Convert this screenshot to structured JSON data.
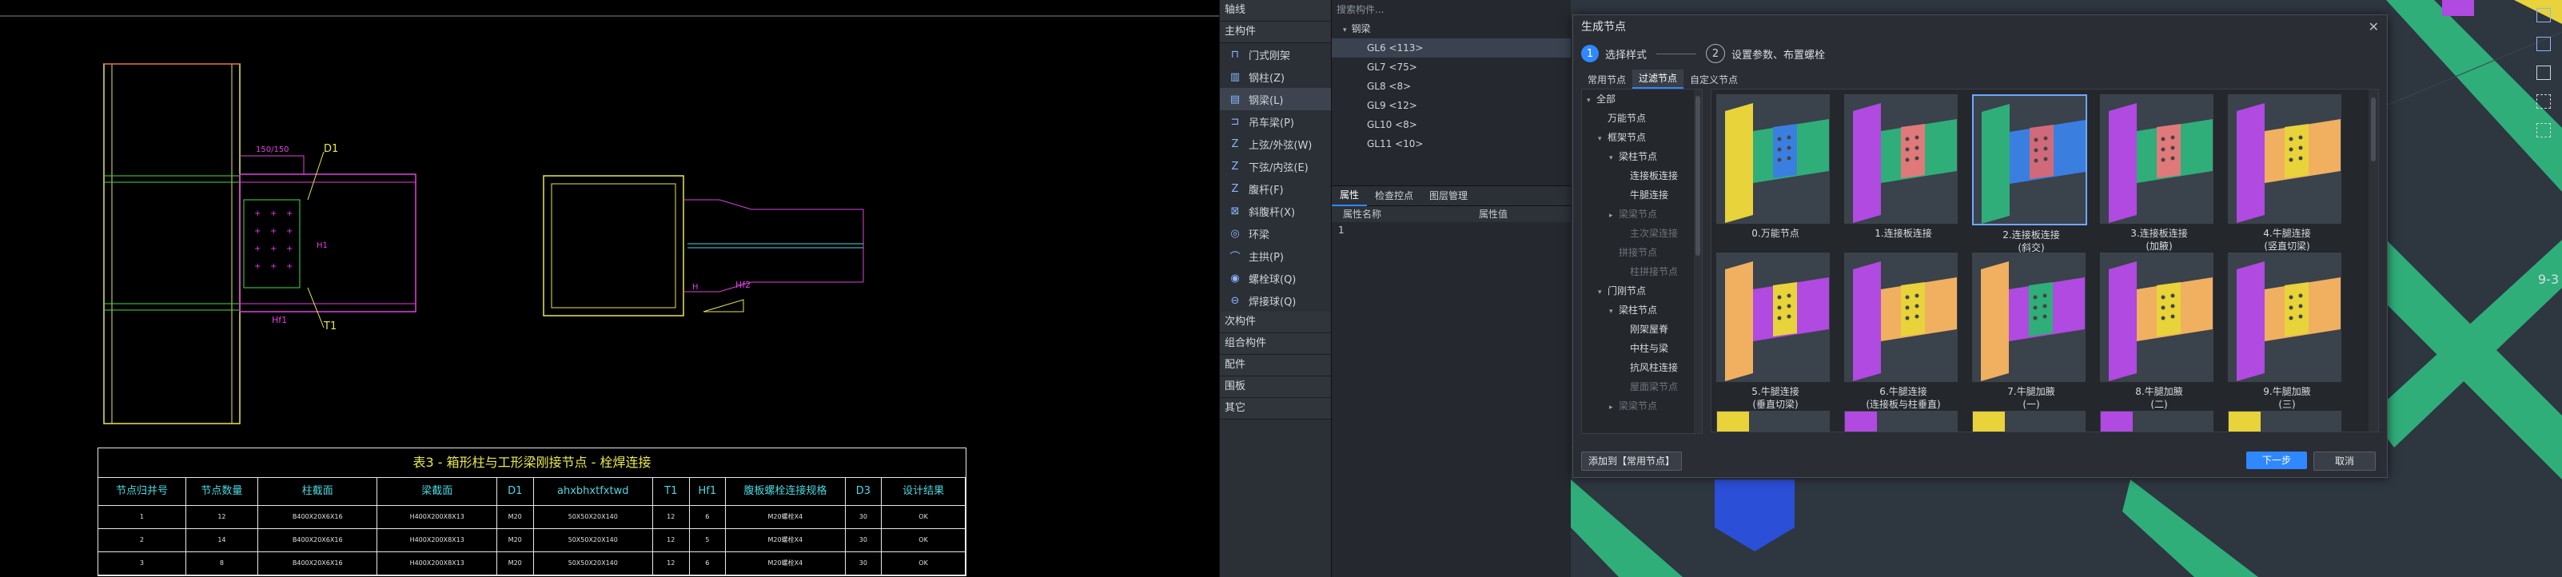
{
  "cad": {
    "labels": {
      "d1": "D1",
      "t1": "T1",
      "h": "H",
      "hf1": "Hf1",
      "hf2": "Hf2",
      "dim_top": "150/150",
      "dim_side": "H1"
    },
    "table": {
      "title": "表3 - 箱形柱与工形梁刚接节点 - 栓焊连接",
      "headers": [
        "节点归并号",
        "节点数量",
        "柱截面",
        "梁截面",
        "D1",
        "ahxbhxtfxtwd",
        "T1",
        "Hf1",
        "腹板螺栓连接规格",
        "D3",
        "设计结果"
      ],
      "rows": [
        [
          "1",
          "12",
          "B400X20X6X16",
          "H400X200X8X13",
          "M20",
          "50X50X20X140",
          "12",
          "6",
          "M20螺栓X4",
          "30",
          "OK"
        ],
        [
          "2",
          "14",
          "B400X20X6X16",
          "H400X200X8X13",
          "M20",
          "50X50X20X140",
          "12",
          "5",
          "M20螺栓X4",
          "30",
          "OK"
        ],
        [
          "3",
          "8",
          "B400X20X6X16",
          "H400X200X8X13",
          "M20",
          "50X50X20X140",
          "12",
          "6",
          "M20螺栓X4",
          "30",
          "OK"
        ]
      ]
    }
  },
  "panel": {
    "cat_axis": "轴线",
    "cat_main": "主构件",
    "items": [
      {
        "label": "门式刚架",
        "icon": "portal-frame-icon",
        "glyph": "⊓"
      },
      {
        "label": "钢柱(Z)",
        "icon": "column-icon",
        "glyph": "▥"
      },
      {
        "label": "钢梁(L)",
        "icon": "beam-icon",
        "glyph": "▤"
      },
      {
        "label": "吊车梁(P)",
        "icon": "crane-beam-icon",
        "glyph": "⊐"
      },
      {
        "label": "上弦/外弦(W)",
        "icon": "top-chord-icon",
        "glyph": "Z"
      },
      {
        "label": "下弦/内弦(E)",
        "icon": "bottom-chord-icon",
        "glyph": "Z"
      },
      {
        "label": "腹杆(F)",
        "icon": "web-member-icon",
        "glyph": "Z"
      },
      {
        "label": "斜腹杆(X)",
        "icon": "diagonal-member-icon",
        "glyph": "⊠"
      },
      {
        "label": "环梁",
        "icon": "ring-beam-icon",
        "glyph": "◎"
      },
      {
        "label": "主拱(P)",
        "icon": "arch-icon",
        "glyph": "⌒"
      },
      {
        "label": "螺栓球(Q)",
        "icon": "bolt-ball-icon",
        "glyph": "◉"
      },
      {
        "label": "焊接球(Q)",
        "icon": "weld-ball-icon",
        "glyph": "⊖"
      }
    ],
    "cat_secondary": "次构件",
    "cat_combined": "组合构件",
    "cat_rebar": "配件",
    "cat_plate": "围板",
    "cat_other": "其它"
  },
  "mid": {
    "search_placeholder": "搜索构件...",
    "tree_root": "钢梁",
    "tree_items": [
      "GL6 <113>",
      "GL7 <75>",
      "GL8 <8>",
      "GL9 <12>",
      "GL10 <8>",
      "GL11 <10>"
    ],
    "tabs": [
      "属性",
      "检查控点",
      "图层管理"
    ],
    "prop_headers": [
      "属性名称",
      "属性值"
    ],
    "prop_row": "1"
  },
  "scene": {
    "edge_label": "9-3"
  },
  "dialog": {
    "title": "生成节点",
    "step1_num": "1",
    "step1_label": "选择样式",
    "step2_num": "2",
    "step2_label": "设置参数、布置螺栓",
    "tabs": [
      "常用节点",
      "过滤节点",
      "自定义节点"
    ],
    "tree": [
      {
        "label": "全部",
        "level": 0,
        "arrow": "▾",
        "dim": false
      },
      {
        "label": "万能节点",
        "level": 1,
        "arrow": "",
        "dim": false
      },
      {
        "label": "框架节点",
        "level": 1,
        "arrow": "▾",
        "dim": false
      },
      {
        "label": "梁柱节点",
        "level": 2,
        "arrow": "▾",
        "dim": false
      },
      {
        "label": "连接板连接",
        "level": 3,
        "arrow": "",
        "dim": false
      },
      {
        "label": "牛腿连接",
        "level": 3,
        "arrow": "",
        "dim": false
      },
      {
        "label": "梁梁节点",
        "level": 2,
        "arrow": "▸",
        "dim": true
      },
      {
        "label": "主次梁连接",
        "level": 3,
        "arrow": "",
        "dim": true
      },
      {
        "label": "拼接节点",
        "level": 2,
        "arrow": "",
        "dim": true
      },
      {
        "label": "柱拼接节点",
        "level": 3,
        "arrow": "",
        "dim": true
      },
      {
        "label": "门刚节点",
        "level": 1,
        "arrow": "▾",
        "dim": false
      },
      {
        "label": "梁柱节点",
        "level": 2,
        "arrow": "▾",
        "dim": false
      },
      {
        "label": "刚架屋脊",
        "level": 3,
        "arrow": "",
        "dim": false
      },
      {
        "label": "中柱与梁",
        "level": 3,
        "arrow": "",
        "dim": false
      },
      {
        "label": "抗风柱连接",
        "level": 3,
        "arrow": "",
        "dim": false
      },
      {
        "label": "屋面梁节点",
        "level": 3,
        "arrow": "",
        "dim": true
      },
      {
        "label": "梁梁节点",
        "level": 2,
        "arrow": "▸",
        "dim": true
      }
    ],
    "cells": [
      {
        "cap1": "0.万能节点",
        "cap2": ""
      },
      {
        "cap1": "1.连接板连接",
        "cap2": ""
      },
      {
        "cap1": "2.连接板连接",
        "cap2": "(斜交)"
      },
      {
        "cap1": "3.连接板连接",
        "cap2": "(加腋)"
      },
      {
        "cap1": "4.牛腿连接",
        "cap2": "(竖直切梁)"
      },
      {
        "cap1": "5.牛腿连接",
        "cap2": "(垂直切梁)"
      },
      {
        "cap1": "6.牛腿连接",
        "cap2": "(连接板与柱垂直)"
      },
      {
        "cap1": "7.牛腿加腋",
        "cap2": "(一)"
      },
      {
        "cap1": "8.牛腿加腋",
        "cap2": "(二)"
      },
      {
        "cap1": "9.牛腿加腋",
        "cap2": "(三)"
      }
    ],
    "add_button": "添加到【常用节点】",
    "next_button": "下一步",
    "cancel_button": "取消"
  },
  "colors": {
    "accent": "#2f88ff",
    "cad_yellow": "#e8e84a",
    "cad_magenta": "#e040e0",
    "cad_green": "#40e040",
    "cad_cyan": "#4ad8e0",
    "beam_green": "#2fae7a",
    "beam_yellow": "#e8d33a"
  }
}
